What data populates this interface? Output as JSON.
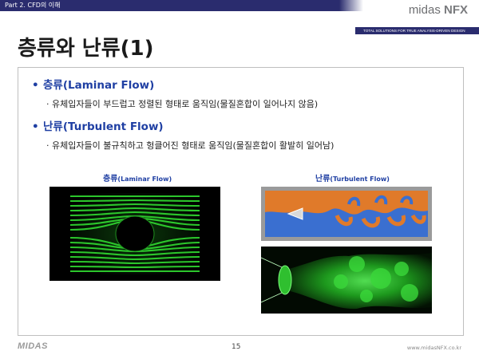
{
  "header": {
    "part_label": "Part 2. CFD의 이해",
    "brand_prefix": "midas ",
    "brand_suffix": "NFX",
    "tagline": "TOTAL SOLUTIONS FOR TRUE ANALYSIS-DRIVEN DESIGN"
  },
  "page_title": "층류와 난류(1)",
  "bullets": [
    {
      "label": "층류(Laminar Flow)",
      "description": "· 유체입자들이 부드럽고 정렬된 형태로 움직임(물질혼합이 일어나지 않음)"
    },
    {
      "label": "난류(Turbulent Flow)",
      "description": "· 유체입자들이 불규칙하고 헝클어진 형태로 움직임(물질혼합이 활발히 일어남)"
    }
  ],
  "images": {
    "laminar_caption_ko": "층류",
    "laminar_caption_en": "(Laminar Flow)",
    "turbulent_caption_ko": "난류",
    "turbulent_caption_en": "(Turbulent Flow)"
  },
  "footer": {
    "logo": "MIDAS",
    "page_number": "15",
    "url": "www.midasNFX.co.kr"
  },
  "colors": {
    "header_bar": "#2a2c6e",
    "bullet_text": "#1f3fa3",
    "flow_green": "#22c322",
    "turbulent_orange": "#e07a2a",
    "turbulent_blue": "#3a6fd0"
  }
}
